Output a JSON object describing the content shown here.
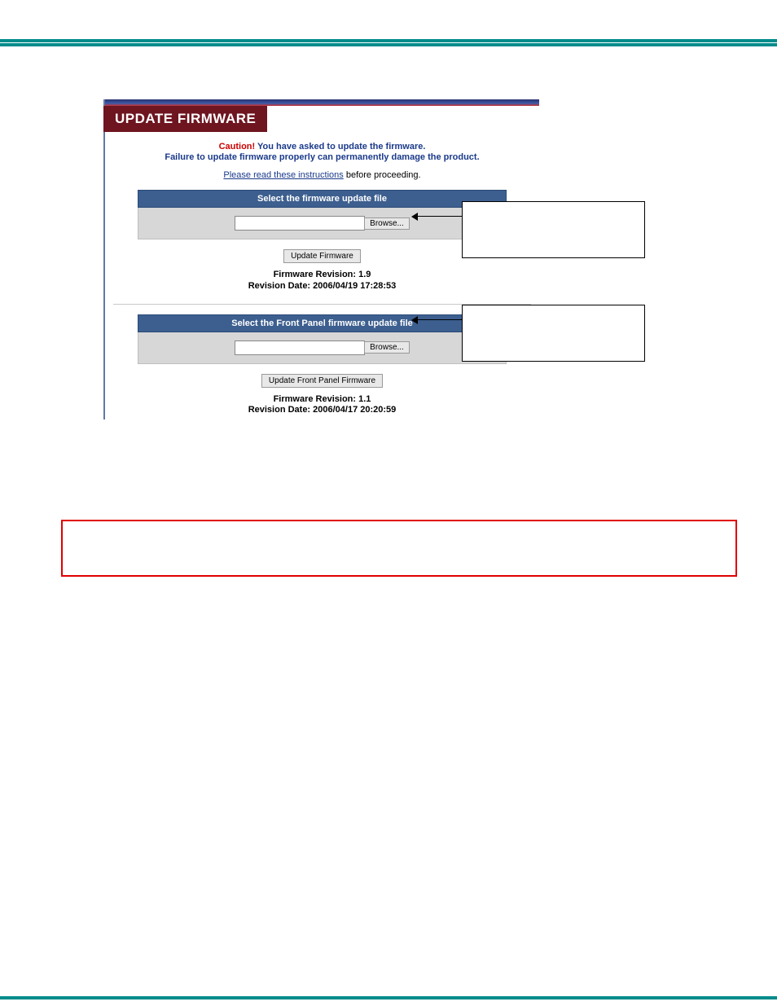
{
  "panel": {
    "title": "UPDATE FIRMWARE",
    "caution_word": "Caution!",
    "caution_rest": " You have asked to update the firmware.",
    "caution_line2": "Failure to update firmware properly can permanently damage the product.",
    "link_text": "Please read these instructions",
    "link_after": " before proceeding."
  },
  "sec1": {
    "head": "Select the firmware update file",
    "browse": "Browse...",
    "button": "Update Firmware",
    "rev": "Firmware Revision: 1.9",
    "date": "Revision Date: 2006/04/19 17:28:53"
  },
  "sec2": {
    "head": "Select the Front Panel firmware update file",
    "browse": "Browse...",
    "button": "Update Front Panel Firmware",
    "rev": "Firmware Revision: 1.1",
    "date": "Revision Date: 2006/04/17 20:20:59"
  }
}
